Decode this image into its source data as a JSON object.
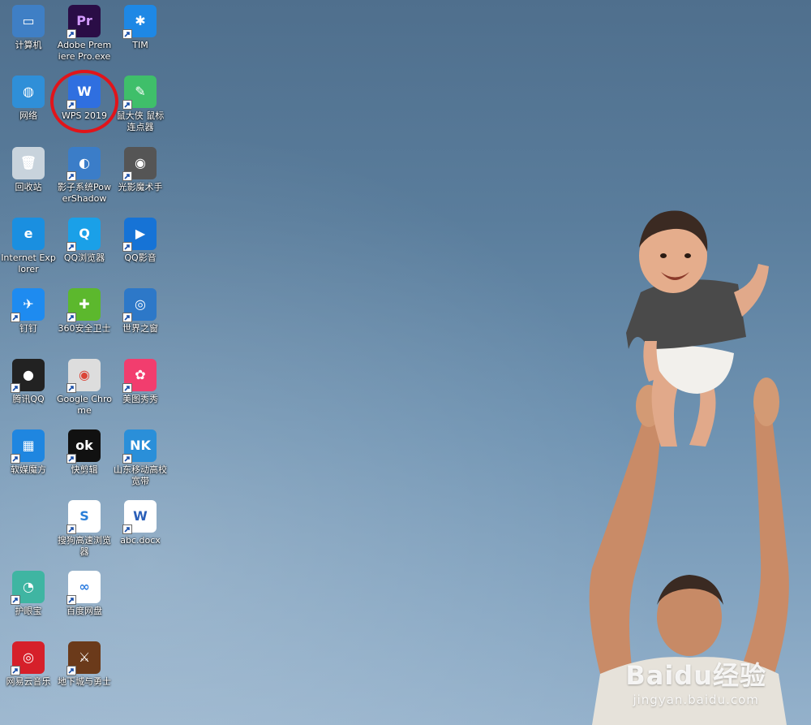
{
  "desktop": {
    "icons": [
      {
        "label": "计算机",
        "color": "#3f7fc5",
        "glyph": "▭",
        "icon": "computer-icon"
      },
      {
        "label": "Adobe Premiere Pro.exe",
        "color": "#2a0d46",
        "glyph": "Pr",
        "fg": "#d49bff",
        "icon": "premiere-pro-icon"
      },
      {
        "label": "TIM",
        "color": "#1e88e5",
        "glyph": "✱",
        "icon": "tim-icon"
      },
      {
        "label": "网络",
        "color": "#2f8fd8",
        "glyph": "◍",
        "icon": "network-icon"
      },
      {
        "label": "WPS 2019",
        "color": "#2f6fe0",
        "glyph": "W",
        "icon": "wps-icon"
      },
      {
        "label": "鼠大侠 鼠标连点器",
        "color": "#3fbf6a",
        "glyph": "✎",
        "icon": "mouse-clicker-icon"
      },
      {
        "label": "回收站",
        "color": "#c8d3dc",
        "glyph": "🗑",
        "icon": "recycle-bin-icon"
      },
      {
        "label": "影子系统PowerShadow",
        "color": "#3b7dc8",
        "glyph": "◐",
        "icon": "powershadow-icon"
      },
      {
        "label": "光影魔术手",
        "color": "#555555",
        "glyph": "◉",
        "icon": "photo-magic-icon"
      },
      {
        "label": "Internet Explorer",
        "color": "#1a8fe0",
        "glyph": "e",
        "icon": "internet-explorer-icon"
      },
      {
        "label": "QQ浏览器",
        "color": "#1aa0e8",
        "glyph": "Q",
        "icon": "qq-browser-icon"
      },
      {
        "label": "QQ影音",
        "color": "#1673d6",
        "glyph": "▶",
        "icon": "qq-player-icon"
      },
      {
        "label": "钉钉",
        "color": "#1e8bf0",
        "glyph": "✈",
        "icon": "dingtalk-icon"
      },
      {
        "label": "360安全卫士",
        "color": "#5cb82d",
        "glyph": "✚",
        "icon": "360-security-icon"
      },
      {
        "label": "世界之窗",
        "color": "#2d78c8",
        "glyph": "◎",
        "icon": "theworld-browser-icon"
      },
      {
        "label": "腾讯QQ",
        "color": "#222222",
        "glyph": "●",
        "icon": "tencent-qq-icon"
      },
      {
        "label": "Google Chrome",
        "color": "#dddddd",
        "glyph": "◉",
        "fg": "#db4437",
        "icon": "google-chrome-icon"
      },
      {
        "label": "美图秀秀",
        "color": "#f23d6e",
        "glyph": "✿",
        "icon": "meitu-icon"
      },
      {
        "label": "软媒魔方",
        "color": "#1f86e0",
        "glyph": "▦",
        "icon": "ruanmei-cube-icon"
      },
      {
        "label": "快剪辑",
        "color": "#111111",
        "glyph": "ok",
        "icon": "kuaijianji-icon"
      },
      {
        "label": "山东移动高校宽带",
        "color": "#2a8fd9",
        "glyph": "NK",
        "icon": "broadband-icon"
      },
      {
        "label": "搜狗高速浏览器",
        "color": "#ffffff",
        "glyph": "S",
        "fg": "#2a7fd8",
        "icon": "sogou-browser-icon"
      },
      {
        "label": "abc.docx",
        "color": "#ffffff",
        "glyph": "W",
        "fg": "#2b5fb8",
        "icon": "word-document-icon"
      },
      {
        "label": "护眼宝",
        "color": "#3fb5a2",
        "glyph": "◔",
        "icon": "eye-protection-icon"
      },
      {
        "label": "百度网盘",
        "color": "#ffffff",
        "glyph": "∞",
        "fg": "#2f7ee0",
        "icon": "baidu-netdisk-icon"
      },
      {
        "label": "网易云音乐",
        "color": "#d6202a",
        "glyph": "◎",
        "icon": "netease-music-icon"
      },
      {
        "label": "地下城与勇士",
        "color": "#6b3a1a",
        "glyph": "⚔",
        "icon": "dnf-game-icon"
      }
    ]
  },
  "watermark": {
    "logo": "Baidu经验",
    "url": "jingyan.baidu.com"
  },
  "colors": {
    "highlight_ring": "#e1141a",
    "sky": "#5a7d9c"
  }
}
